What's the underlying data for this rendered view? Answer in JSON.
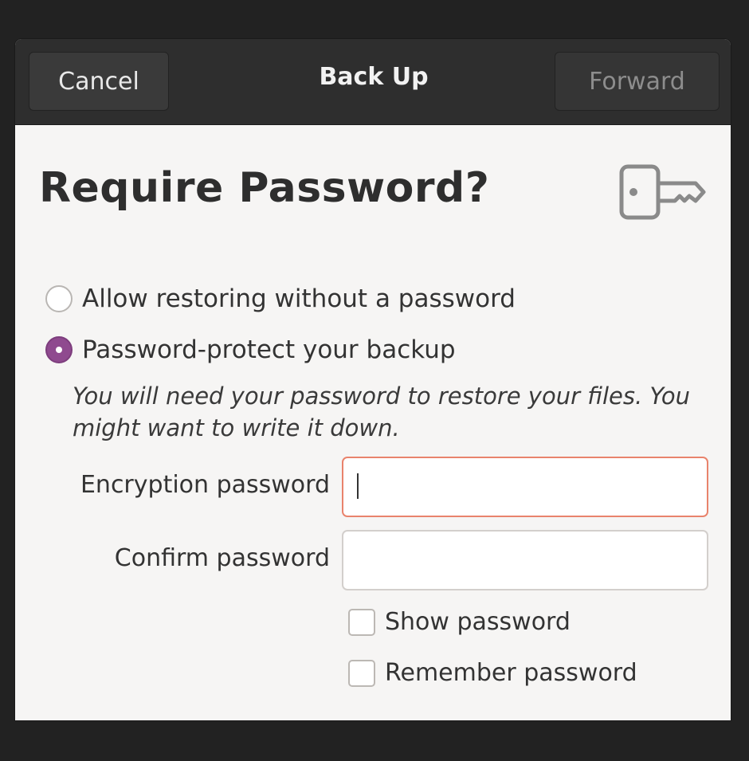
{
  "headerbar": {
    "title": "Back Up",
    "cancel_label": "Cancel",
    "forward_label": "Forward"
  },
  "page": {
    "title": "Require Password?",
    "icon": "key-icon"
  },
  "options": [
    {
      "label": "Allow restoring without a password",
      "selected": false
    },
    {
      "label": "Password-protect your backup",
      "selected": true
    }
  ],
  "hint": "You will need your password to restore your files. You might want to write it down.",
  "fields": {
    "encryption_label": "Encryption password",
    "encryption_value": "",
    "confirm_label": "Confirm password",
    "confirm_value": ""
  },
  "checkboxes": {
    "show_password_label": "Show password",
    "show_password_checked": false,
    "remember_password_label": "Remember password",
    "remember_password_checked": false
  },
  "colors": {
    "accent": "#8f4a8f",
    "focus_border": "#e9836c",
    "headerbar_bg": "#2e2e2e"
  }
}
